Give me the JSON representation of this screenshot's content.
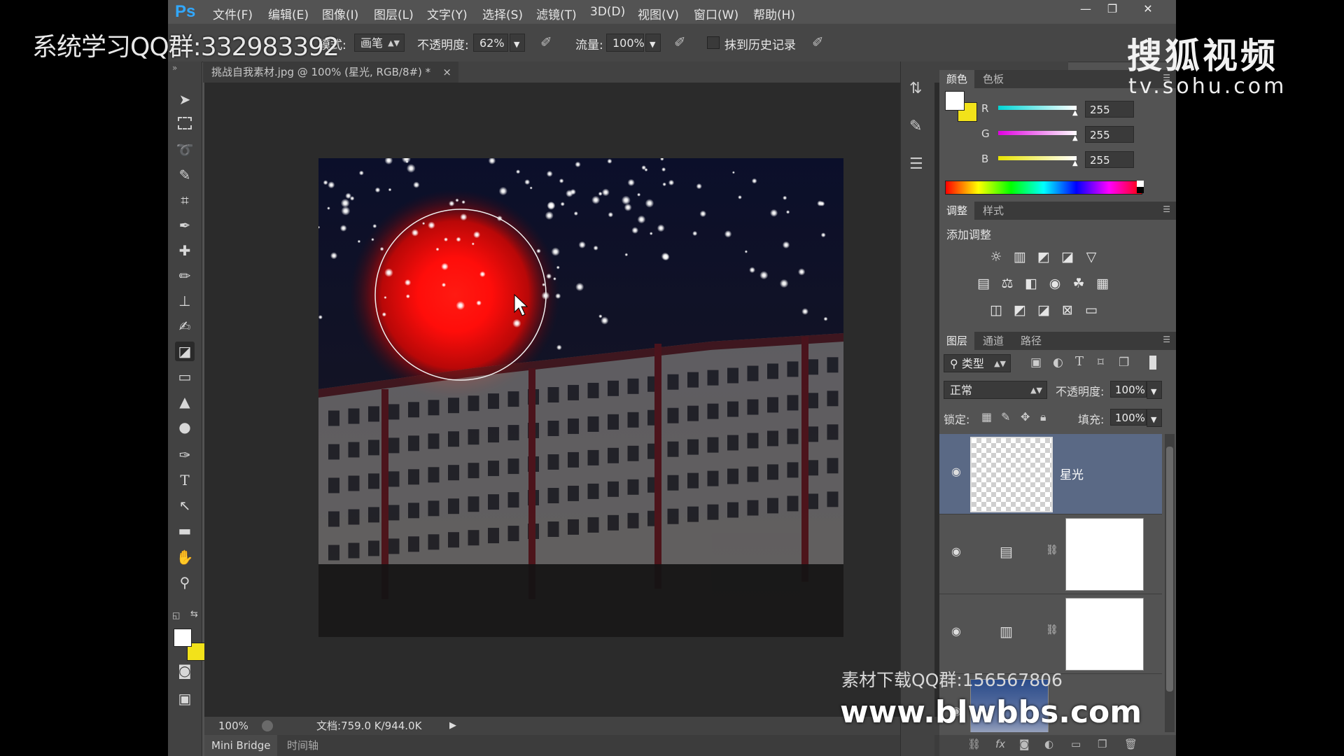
{
  "app": {
    "logo": "Ps",
    "menus": [
      "文件(F)",
      "编辑(E)",
      "图像(I)",
      "图层(L)",
      "文字(Y)",
      "选择(S)",
      "滤镜(T)",
      "3D(D)",
      "视图(V)",
      "窗口(W)",
      "帮助(H)"
    ],
    "window_buttons": [
      "—",
      "❐",
      "✕"
    ]
  },
  "options": {
    "mode_label": "模式:",
    "mode_value": "画笔",
    "opacity_label": "不透明度:",
    "opacity_value": "62%",
    "flow_label": "流量:",
    "flow_value": "100%",
    "history_label": "抹到历史记录"
  },
  "document": {
    "tab_title": "挑战自我素材.jpg @ 100% (星光, RGB/8#) *",
    "tab_close": "×",
    "zoom": "100%",
    "doc_info": "文档:759.0 K/944.0K",
    "bottom_tabs": [
      "Mini Bridge",
      "时间轴"
    ]
  },
  "color_panel": {
    "tabs": [
      "颜色",
      "色板"
    ],
    "channels": [
      {
        "label": "R",
        "value": "255",
        "color": "#22d3d3"
      },
      {
        "label": "G",
        "value": "255",
        "color": "#e02ce0"
      },
      {
        "label": "B",
        "value": "255",
        "color": "#e8e41e"
      }
    ],
    "foreground": "#ffffff",
    "background": "#f2e21a"
  },
  "adjustments_panel": {
    "tabs": [
      "调整",
      "样式"
    ],
    "title": "添加调整"
  },
  "layers_panel": {
    "tabs": [
      "图层",
      "通道",
      "路径"
    ],
    "filter_label": "类型",
    "blend_mode": "正常",
    "opacity_label": "不透明度:",
    "opacity_value": "100%",
    "lock_label": "锁定:",
    "fill_label": "填充:",
    "fill_value": "100%",
    "layers": [
      {
        "name": "星光",
        "selected": true
      },
      {
        "name": "",
        "selected": false
      },
      {
        "name": "",
        "selected": false
      },
      {
        "name": "",
        "selected": false
      }
    ]
  },
  "overlays": {
    "qq_group_left": "系统学习QQ群:332983392",
    "sohu_brand": "搜狐视频",
    "sohu_url": "tv.sohu.com",
    "material_qq": "素材下载QQ群:156567806",
    "site_url": "www.blwbbs.com"
  }
}
